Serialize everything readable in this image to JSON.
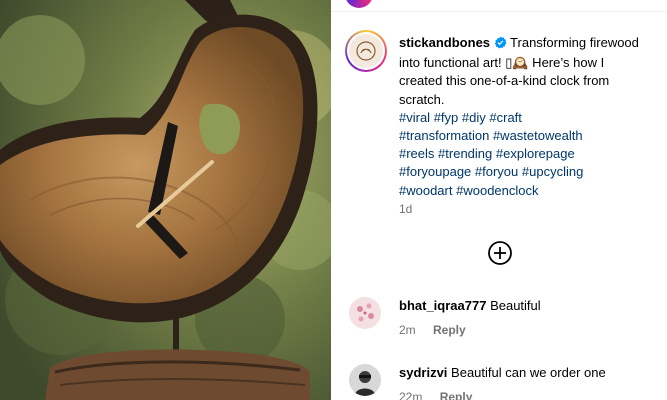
{
  "post": {
    "username": "stickandbones",
    "caption_text": "Transforming firewood into functional art! ▯🕰️ Here’s how I created this one-of-a-kind clock from scratch.",
    "hashtags": [
      "#viral",
      "#fyp",
      "#diy",
      "#craft",
      "#transformation",
      "#wastetowealth",
      "#reels",
      "#trending",
      "#explorepage",
      "#foryoupage",
      "#foryou",
      "#upcycling",
      "#woodart",
      "#woodenclock"
    ],
    "time": "1d"
  },
  "comments": [
    {
      "username": "bhat_iqraa777",
      "text": "Beautiful",
      "time": "2m",
      "reply": "Reply"
    },
    {
      "username": "sydrizvi",
      "text": "Beautiful can we order one",
      "time": "22m",
      "reply": "Reply"
    }
  ],
  "colors": {
    "hashtag": "#00376b",
    "verified": "#0095f6",
    "muted": "#737373"
  },
  "icons": {
    "verified": "verified-badge-icon",
    "more_comments": "plus-circle-icon"
  }
}
